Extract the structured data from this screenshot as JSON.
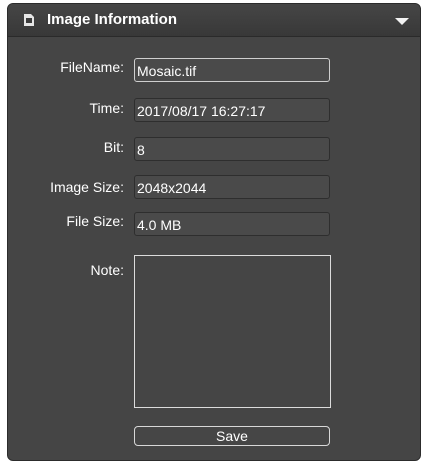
{
  "panel": {
    "title": "Image Information",
    "title_icon": "image-file-icon",
    "collapse_icon": "chevron-down-icon"
  },
  "fields": {
    "filename": {
      "label": "FileName:",
      "value": "Mosaic.tif"
    },
    "time": {
      "label": "Time:",
      "value": "2017/08/17 16:27:17"
    },
    "bit": {
      "label": "Bit:",
      "value": "8"
    },
    "image_size": {
      "label": "Image Size:",
      "value": "2048x2044"
    },
    "file_size": {
      "label": "File Size:",
      "value": "4.0 MB"
    },
    "note": {
      "label": "Note:",
      "value": ""
    }
  },
  "actions": {
    "save_label": "Save"
  },
  "colors": {
    "panel_bg": "#454545",
    "text": "#ffffff"
  }
}
